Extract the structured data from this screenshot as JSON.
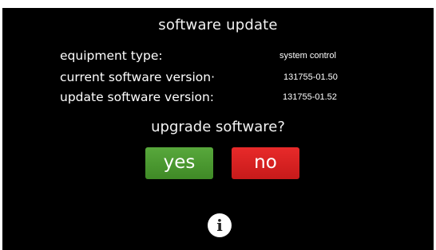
{
  "dialog": {
    "title": "software update",
    "rows": [
      {
        "label": "equipment type:",
        "value": "system control"
      },
      {
        "label": "current software version·",
        "value": "131755-01.50"
      },
      {
        "label": "update software version:",
        "value": "131755-01.52"
      }
    ],
    "question": "upgrade software?",
    "yes_label": "yes",
    "no_label": "no",
    "info_label": "i"
  },
  "colors": {
    "background": "#000000",
    "yes_button": "#4c9a32",
    "no_button": "#dc2222",
    "info_button": "#ffffff"
  },
  "icons": {
    "info": "info-icon"
  }
}
